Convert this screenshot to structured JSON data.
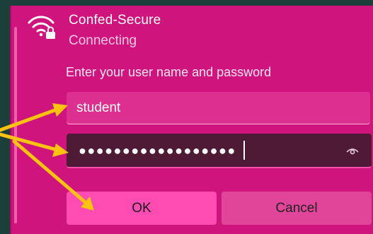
{
  "network": {
    "ssid": "Confed-Secure",
    "status": "Connecting",
    "icon": "wifi-secured-icon"
  },
  "form": {
    "prompt": "Enter your user name and password",
    "username_value": "student",
    "password_masked": "●●●●●●●●●●●●●●●●●●"
  },
  "buttons": {
    "ok_label": "OK",
    "cancel_label": "Cancel"
  },
  "colors": {
    "panel": "#d0147e",
    "password_field": "#4e1a36",
    "ok_button": "#ff4cb3",
    "annotation_arrows": "#ffc20e"
  }
}
